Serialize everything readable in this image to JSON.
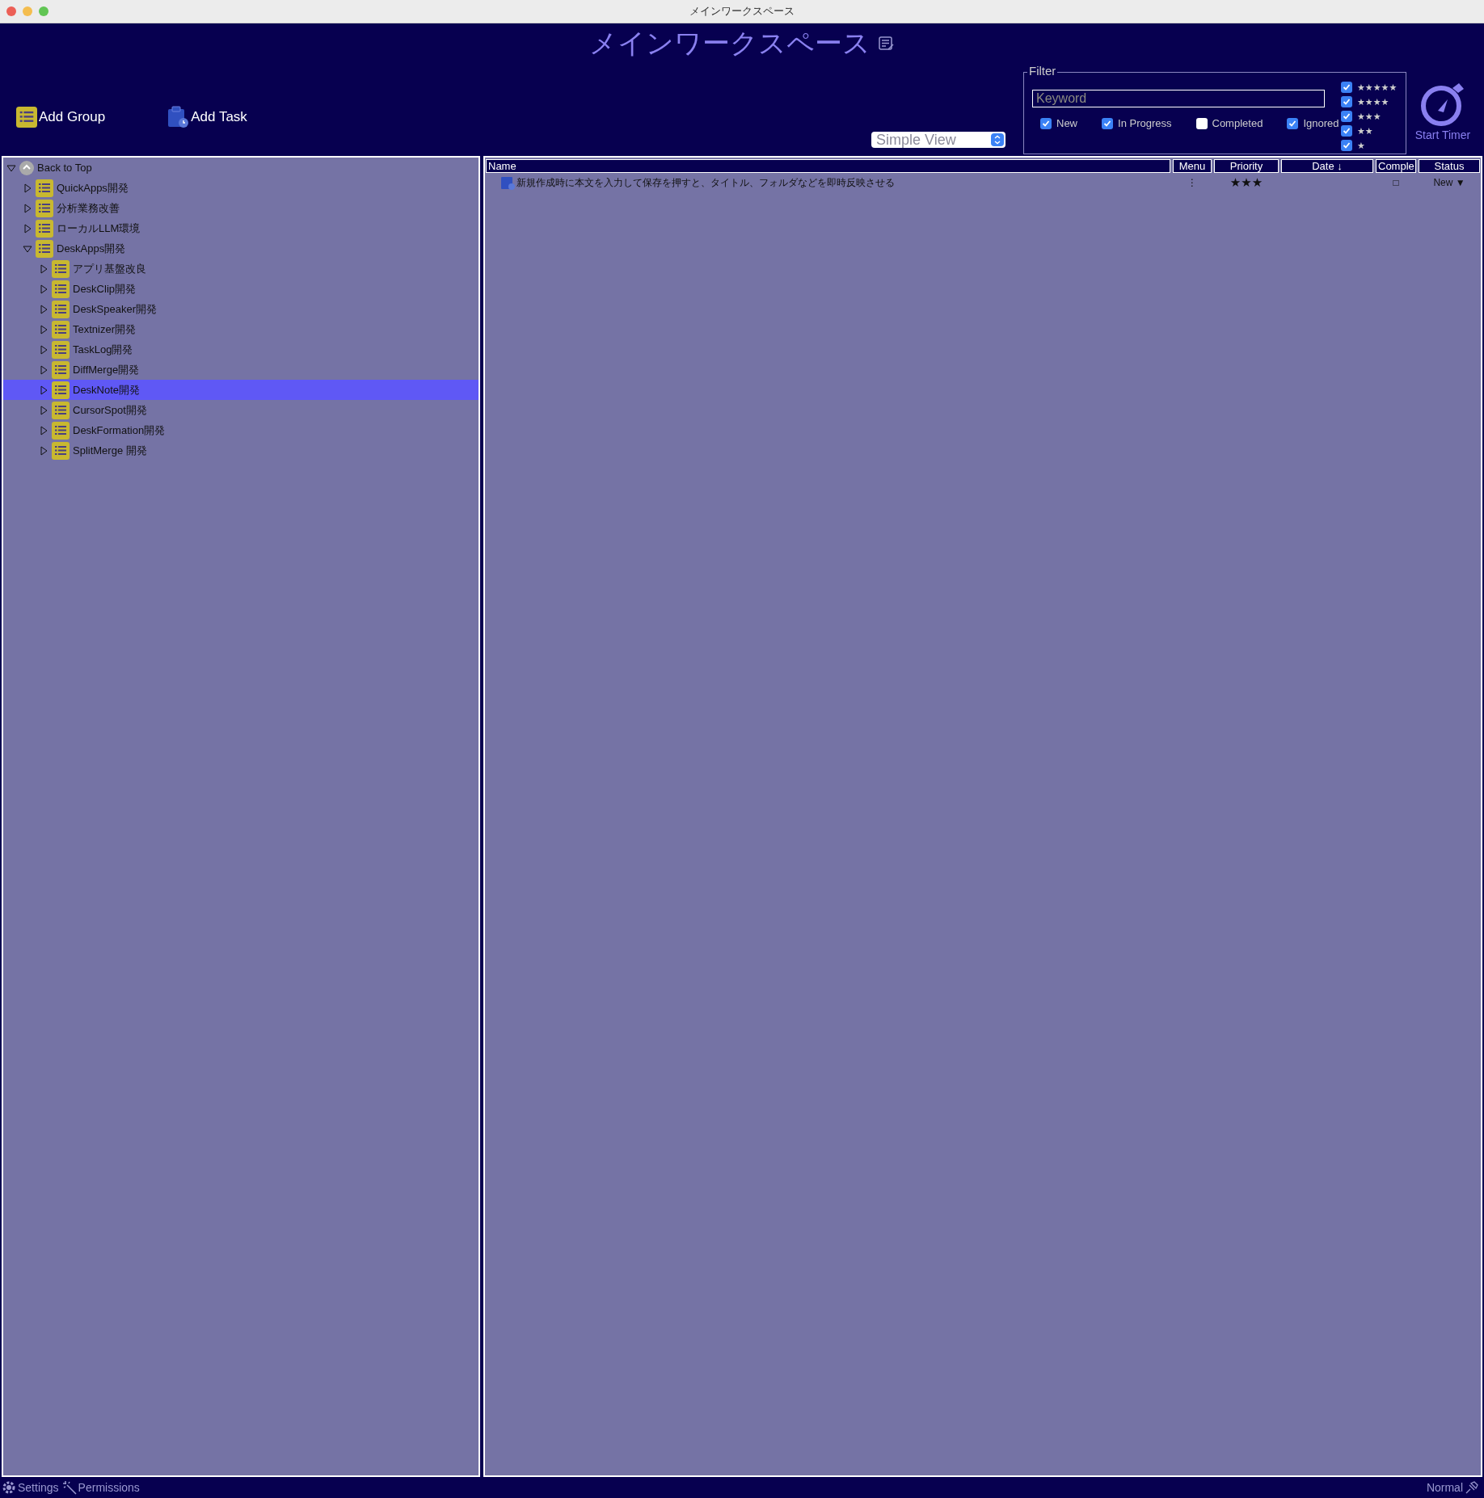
{
  "window": {
    "title": "メインワークスペース"
  },
  "header": {
    "title": "メインワークスペース",
    "buttons": [
      {
        "kind": "group",
        "label": "Add Group"
      },
      {
        "kind": "task",
        "label": "Add Task"
      }
    ],
    "view_select": {
      "value": "Simple View"
    },
    "filter": {
      "legend": "Filter",
      "keyword": {
        "placeholder": "Keyword"
      },
      "statuses": [
        {
          "label": "New",
          "checked": true
        },
        {
          "label": "In Progress",
          "checked": true
        },
        {
          "label": "Completed",
          "checked": false
        },
        {
          "label": "Ignored",
          "checked": true
        }
      ],
      "stars": [
        {
          "label": "★★★★★",
          "checked": true
        },
        {
          "label": "★★★★",
          "checked": true
        },
        {
          "label": "★★★",
          "checked": true
        },
        {
          "label": "★★",
          "checked": true
        },
        {
          "label": "★",
          "checked": true
        }
      ]
    },
    "timer": {
      "label": "Start Timer"
    }
  },
  "tree": [
    {
      "label": "Back to Top",
      "kind": "top",
      "expanded": true,
      "selected": false,
      "children": [
        {
          "label": "QuickApps開発",
          "kind": "group",
          "expanded": false,
          "selected": false
        },
        {
          "label": "分析業務改善",
          "kind": "group",
          "expanded": false,
          "selected": false
        },
        {
          "label": "ローカルLLM環境",
          "kind": "group",
          "expanded": false,
          "selected": false
        },
        {
          "label": "DeskApps開発",
          "kind": "group",
          "expanded": true,
          "selected": false,
          "children": [
            {
              "label": "アプリ基盤改良",
              "kind": "group",
              "expanded": false,
              "selected": false
            },
            {
              "label": "DeskClip開発",
              "kind": "group",
              "expanded": false,
              "selected": false
            },
            {
              "label": "DeskSpeaker開発",
              "kind": "group",
              "expanded": false,
              "selected": false
            },
            {
              "label": "Textnizer開発",
              "kind": "group",
              "expanded": false,
              "selected": false
            },
            {
              "label": "TaskLog開発",
              "kind": "group",
              "expanded": false,
              "selected": false
            },
            {
              "label": "DiffMerge開発",
              "kind": "group",
              "expanded": false,
              "selected": false
            },
            {
              "label": "DeskNote開発",
              "kind": "group",
              "expanded": false,
              "selected": true
            },
            {
              "label": "CursorSpot開発",
              "kind": "group",
              "expanded": false,
              "selected": false
            },
            {
              "label": "DeskFormation開発",
              "kind": "group",
              "expanded": false,
              "selected": false
            },
            {
              "label": "SplitMerge 開発",
              "kind": "group",
              "expanded": false,
              "selected": false
            }
          ]
        }
      ]
    }
  ],
  "table": {
    "columns": [
      "Name",
      "Menu",
      "Priority",
      "Date ↓",
      "Comple",
      "Status"
    ],
    "rows": [
      {
        "name": "新規作成時に本文を入力して保存を押すと、タイトル、フォルダなどを即時反映させる",
        "menu": "⋮",
        "priority": "★★★",
        "date": "",
        "completed": "□",
        "status": "New ▼"
      }
    ]
  },
  "status_bar": {
    "left": [
      {
        "kind": "settings",
        "label": "Settings"
      },
      {
        "kind": "permissions",
        "label": "Permissions"
      }
    ],
    "right": {
      "label": "Normal"
    }
  }
}
